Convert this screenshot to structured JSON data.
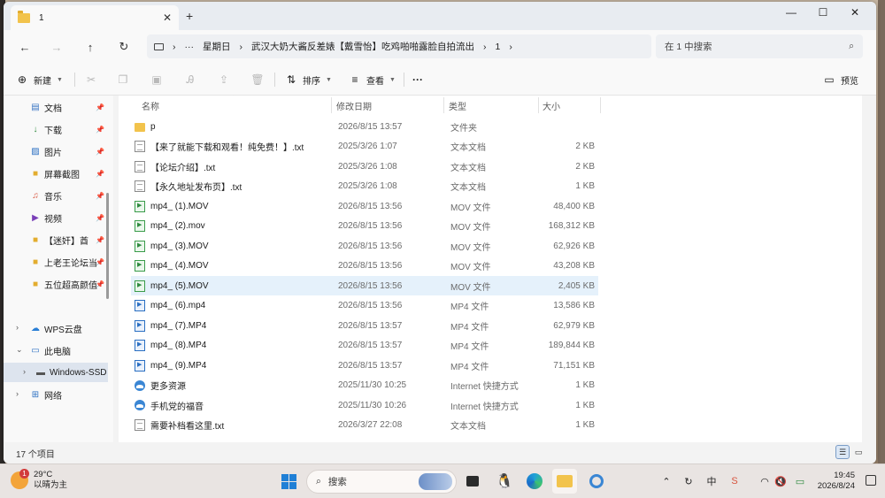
{
  "window": {
    "tab_title": "1",
    "tab_close": "✕",
    "new_tab": "+",
    "controls": {
      "minimize": "—",
      "maximize": "☐",
      "close": "✕"
    }
  },
  "address": {
    "path": [
      "星期日",
      "武汉大奶大酱反差婊【戴雪怡】吃鸡啪啪露脸自拍流出",
      "1"
    ],
    "more": "···",
    "separator": "›",
    "search_placeholder": "在 1 中搜索"
  },
  "toolbar": {
    "new_label": "新建",
    "sort_label": "排序",
    "view_label": "查看",
    "more_label": "···",
    "preview_label": "预览"
  },
  "sidebar": {
    "quick": [
      {
        "label": "文档",
        "icon": "document-icon"
      },
      {
        "label": "下载",
        "icon": "download-icon"
      },
      {
        "label": "图片",
        "icon": "pictures-icon"
      },
      {
        "label": "屏幕截图",
        "icon": "folder-icon"
      },
      {
        "label": "音乐",
        "icon": "music-icon"
      },
      {
        "label": "视频",
        "icon": "video-icon"
      },
      {
        "label": "【迷奸】酋",
        "icon": "folder-icon"
      },
      {
        "label": "上老王论坛当",
        "icon": "folder-icon"
      },
      {
        "label": "五位超高颜值",
        "icon": "folder-icon"
      }
    ],
    "tree": [
      {
        "label": "WPS云盘",
        "icon": "cloud-icon"
      },
      {
        "label": "此电脑",
        "icon": "computer-icon"
      },
      {
        "label": "Windows-SSD",
        "icon": "drive-icon"
      },
      {
        "label": "网络",
        "icon": "network-icon"
      }
    ]
  },
  "columns": {
    "name": "名称",
    "date": "修改日期",
    "type": "类型",
    "size": "大小"
  },
  "files": [
    {
      "name": "p",
      "date": "2026/8/15 13:57",
      "type": "文件夹",
      "size": "",
      "kind": "folder"
    },
    {
      "name": "【来了就能下载和观看！纯免费！】.txt",
      "date": "2025/3/26 1:07",
      "type": "文本文档",
      "size": "2 KB",
      "kind": "txt"
    },
    {
      "name": "【论坛介绍】.txt",
      "date": "2025/3/26 1:08",
      "type": "文本文档",
      "size": "2 KB",
      "kind": "txt"
    },
    {
      "name": "【永久地址发布页】.txt",
      "date": "2025/3/26 1:08",
      "type": "文本文档",
      "size": "1 KB",
      "kind": "txt"
    },
    {
      "name": "mp4_ (1).MOV",
      "date": "2026/8/15 13:56",
      "type": "MOV 文件",
      "size": "48,400 KB",
      "kind": "mov"
    },
    {
      "name": "mp4_ (2).mov",
      "date": "2026/8/15 13:56",
      "type": "MOV 文件",
      "size": "168,312 KB",
      "kind": "mov"
    },
    {
      "name": "mp4_ (3).MOV",
      "date": "2026/8/15 13:56",
      "type": "MOV 文件",
      "size": "62,926 KB",
      "kind": "mov"
    },
    {
      "name": "mp4_ (4).MOV",
      "date": "2026/8/15 13:56",
      "type": "MOV 文件",
      "size": "43,208 KB",
      "kind": "mov"
    },
    {
      "name": "mp4_ (5).MOV",
      "date": "2026/8/15 13:56",
      "type": "MOV 文件",
      "size": "2,405 KB",
      "kind": "mov"
    },
    {
      "name": "mp4_ (6).mp4",
      "date": "2026/8/15 13:56",
      "type": "MP4 文件",
      "size": "13,586 KB",
      "kind": "mp4"
    },
    {
      "name": "mp4_ (7).MP4",
      "date": "2026/8/15 13:57",
      "type": "MP4 文件",
      "size": "62,979 KB",
      "kind": "mp4"
    },
    {
      "name": "mp4_ (8).MP4",
      "date": "2026/8/15 13:57",
      "type": "MP4 文件",
      "size": "189,844 KB",
      "kind": "mp4"
    },
    {
      "name": "mp4_ (9).MP4",
      "date": "2026/8/15 13:57",
      "type": "MP4 文件",
      "size": "71,151 KB",
      "kind": "mp4"
    },
    {
      "name": "更多资源",
      "date": "2025/11/30 10:25",
      "type": "Internet 快捷方式",
      "size": "1 KB",
      "kind": "url"
    },
    {
      "name": "手机党的福音",
      "date": "2025/11/30 10:26",
      "type": "Internet 快捷方式",
      "size": "1 KB",
      "kind": "url"
    },
    {
      "name": "需要补档看这里.txt",
      "date": "2026/3/27 22:08",
      "type": "文本文档",
      "size": "1 KB",
      "kind": "txt"
    }
  ],
  "selected_row": 8,
  "status": {
    "count": "17 个项目"
  },
  "taskbar": {
    "weather_temp": "29°C",
    "weather_desc": "以晴为主",
    "weather_badge": "1",
    "search_label": "搜索",
    "time": "19:45",
    "date": "2026/8/24"
  }
}
